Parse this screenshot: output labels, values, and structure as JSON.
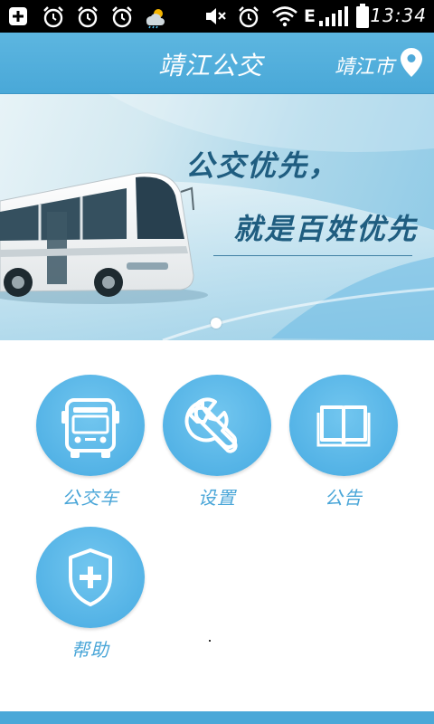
{
  "status_bar": {
    "time": "13:34",
    "network_type": "E",
    "icons": [
      "add-notification-icon",
      "alarm-icon",
      "alarm-icon",
      "alarm-icon",
      "weather-icon",
      "mute-icon",
      "alarm-icon",
      "wifi-icon",
      "signal-icon",
      "battery-icon"
    ]
  },
  "header": {
    "title": "靖江公交",
    "city": "靖江市",
    "location_icon": "location-pin-icon"
  },
  "banner": {
    "slogan_line1": "公交优先，",
    "slogan_line2": "就是百姓优先",
    "page_count": 1,
    "active_page": 1
  },
  "menu": {
    "items": [
      {
        "label": "公交车",
        "icon": "bus-icon"
      },
      {
        "label": "设置",
        "icon": "wrench-icon"
      },
      {
        "label": "公告",
        "icon": "book-icon"
      },
      {
        "label": "帮助",
        "icon": "shield-plus-icon"
      }
    ]
  },
  "colors": {
    "accent": "#4aa8d8",
    "title_bar": "#52addb",
    "menu_circle": "#5ab7e8",
    "menu_label": "#4aa6d8",
    "slogan": "#1f5d80"
  }
}
